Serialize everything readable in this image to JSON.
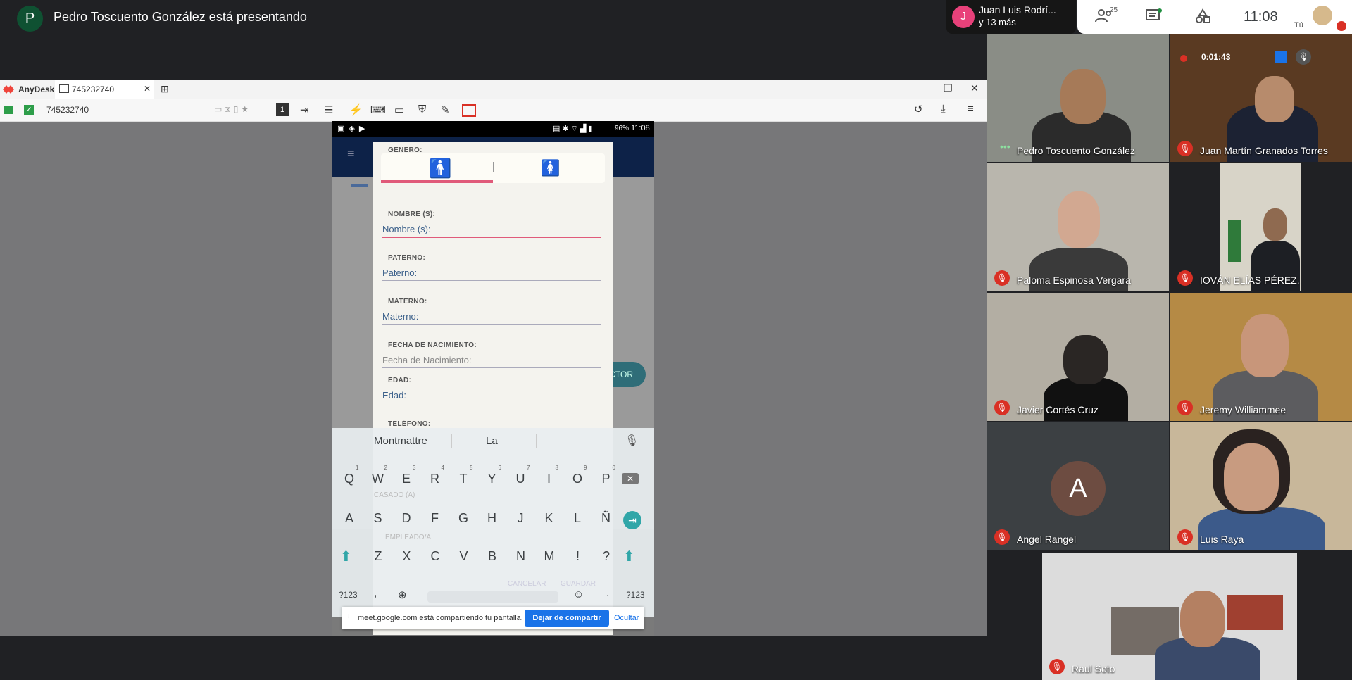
{
  "meet": {
    "presenter_initial": "P",
    "presenter_banner": "Pedro Toscuento González está presentando",
    "joined": {
      "initial": "J",
      "name": "Juan Luis Rodrí...",
      "more": "y 13 más"
    },
    "participants_count": "25",
    "time": "11:08",
    "self_label": "Tú",
    "recording_time": "0:01:43"
  },
  "anydesk": {
    "app_name": "AnyDesk",
    "tab_label": "745232740",
    "address": "745232740",
    "display_num": "1"
  },
  "phone": {
    "status": {
      "battery": "96%",
      "time": "11:08"
    },
    "behind_button": "CTOR",
    "form": {
      "genero_label": "GENERO:",
      "nombre_label": "NOMBRE (S):",
      "nombre_placeholder": "Nombre (s):",
      "paterno_label": "PATERNO:",
      "paterno_placeholder": "Paterno:",
      "materno_label": "MATERNO:",
      "materno_placeholder": "Materno:",
      "fecha_label": "FECHA DE NACIMIENTO:",
      "fecha_placeholder": "Fecha de Nacimiento:",
      "edad_label": "EDAD:",
      "edad_placeholder": "Edad:",
      "telefono_label": "TELÉFONO:",
      "faded_casado": "CASADO (A)",
      "faded_empleado": "EMPLEADO/A",
      "faded_cancelar": "CANCELAR",
      "faded_guardar": "GUARDAR"
    },
    "keyboard": {
      "suggestions": [
        "Montmattre",
        "La"
      ],
      "row1": [
        "Q",
        "W",
        "E",
        "R",
        "T",
        "Y",
        "U",
        "I",
        "O",
        "P"
      ],
      "row1_hints": [
        "1",
        "2",
        "3",
        "4",
        "5",
        "6",
        "7",
        "8",
        "9",
        "0"
      ],
      "row2": [
        "A",
        "S",
        "D",
        "F",
        "G",
        "H",
        "J",
        "K",
        "L",
        "Ñ"
      ],
      "row3": [
        "Z",
        "X",
        "C",
        "V",
        "B",
        "N",
        "M",
        "!",
        "?"
      ],
      "sym_label": "?123",
      "comma": ",",
      "period": "."
    },
    "sharebar": {
      "message": "meet.google.com está compartiendo tu pantalla.",
      "stop_button": "Dejar de compartir",
      "hide_link": "Ocultar"
    }
  },
  "tiles": [
    {
      "name": "Pedro Toscuento González",
      "muted": false
    },
    {
      "name": "Juan Martín Granados Torres",
      "muted": true
    },
    {
      "name": "Paloma Espinosa Vergara",
      "muted": true
    },
    {
      "name": "IOVÁN ELÍAS PÉREZ.",
      "muted": true
    },
    {
      "name": "Javier Cortés Cruz",
      "muted": true
    },
    {
      "name": "Jeremy Williammee",
      "muted": true
    },
    {
      "name": "Angel Rangel",
      "muted": true,
      "initial": "A"
    },
    {
      "name": "Luis Raya",
      "muted": true
    },
    {
      "name": "Raul Soto",
      "muted": true
    }
  ]
}
